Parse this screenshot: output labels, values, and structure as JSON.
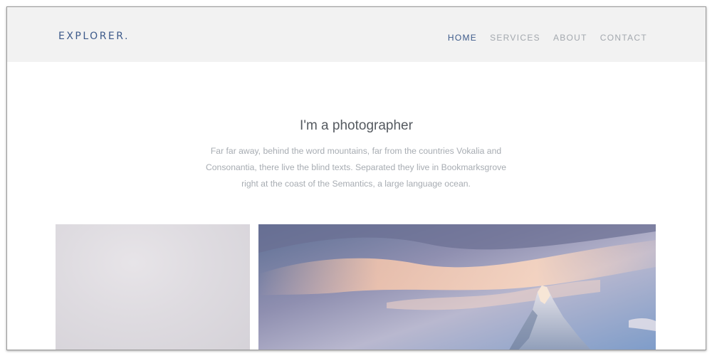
{
  "header": {
    "brand": "EXPLORER.",
    "nav": [
      {
        "label": "HOME",
        "active": true
      },
      {
        "label": "SERVICES",
        "active": false
      },
      {
        "label": "ABOUT",
        "active": false
      },
      {
        "label": "CONTACT",
        "active": false
      }
    ]
  },
  "hero": {
    "title": "I'm a photographer",
    "text_lines": [
      "Far far away, behind the word mountains, far from the countries Vokalia and",
      "Consonantia, there live the blind texts. Separated they live in Bookmarksgrove",
      "right at the coast of the Semantics, a large language ocean."
    ]
  },
  "colors": {
    "brand": "#3d5a8a",
    "nav_inactive": "#a3a8ae",
    "header_bg": "#f2f2f2",
    "title": "#555a60",
    "body_text": "#a7acb2"
  },
  "gallery": {
    "photos": [
      {
        "subject": "misty pale sky"
      },
      {
        "subject": "snowy mountain peak at sunset"
      }
    ]
  }
}
